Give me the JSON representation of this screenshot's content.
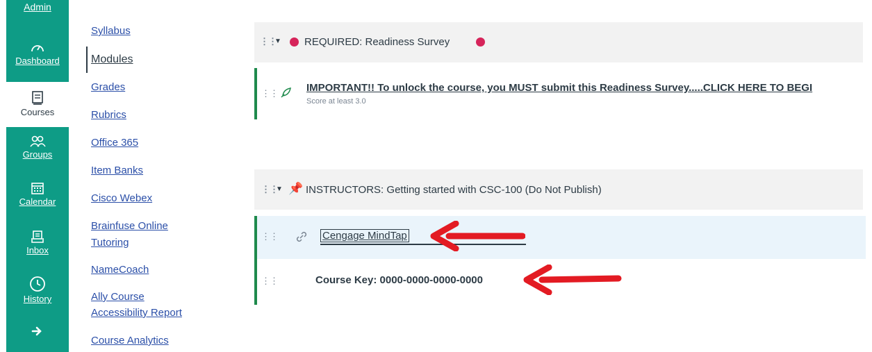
{
  "global_nav": {
    "admin": "Admin",
    "dashboard": "Dashboard",
    "courses": "Courses",
    "groups": "Groups",
    "calendar": "Calendar",
    "inbox": "Inbox",
    "history": "History"
  },
  "course_nav": {
    "items": [
      "Syllabus",
      "Modules",
      "Grades",
      "Rubrics",
      "Office 365",
      "Item Banks",
      "Cisco Webex",
      "Brainfuse Online",
      "Tutoring",
      "NameCoach",
      "Ally Course",
      "Accessibility Report",
      "Course Analytics"
    ]
  },
  "modules": [
    {
      "title": "REQUIRED: Readiness Survey",
      "items": [
        {
          "title": "IMPORTANT!! To unlock the course, you MUST submit this Readiness Survey.....CLICK HERE TO BEGI",
          "subtitle": "Score at least 3.0"
        }
      ]
    },
    {
      "title": "INSTRUCTORS: Getting started with CSC-100 (Do Not Publish)",
      "items": [
        {
          "title": "Cengage MindTap"
        },
        {
          "title": "Course Key: 0000-0000-0000-0000"
        }
      ]
    }
  ],
  "colors": {
    "nav_teal": "#0e9c86",
    "module_bar": "#1e8a4c",
    "required_dot": "#d6245a",
    "arrow": "#e31b23"
  }
}
